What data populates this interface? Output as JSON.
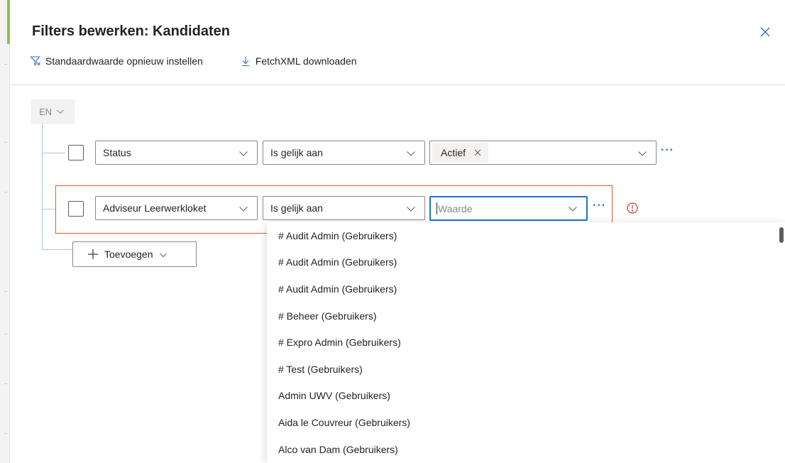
{
  "dialog": {
    "title": "Filters bewerken: Kandidaten",
    "commands": {
      "reset_label": "Standaardwaarde opnieuw instellen",
      "download_label": "FetchXML downloaden"
    }
  },
  "group": {
    "operator_label": "EN"
  },
  "rows": [
    {
      "field": "Status",
      "operator": "Is gelijk aan",
      "value_tag": "Actief",
      "more": "···"
    },
    {
      "field": "Adviseur Leerwerkloket",
      "operator": "Is gelijk aan",
      "value_placeholder": "Waarde",
      "more": "···"
    }
  ],
  "add_button": {
    "label": "Toevoegen"
  },
  "dropdown": {
    "options": [
      "# Audit Admin (Gebruikers)",
      "# Audit Admin (Gebruikers)",
      "# Audit Admin (Gebruikers)",
      "# Beheer (Gebruikers)",
      "# Expro Admin (Gebruikers)",
      "# Test (Gebruikers)",
      "Admin UWV (Gebruikers)",
      "Aida le Couvreur (Gebruikers)",
      "Alco van Dam (Gebruikers)"
    ]
  },
  "colors": {
    "accent": "#1f72c8",
    "error": "#d13438",
    "error_border": "#e05a2b",
    "tree_line": "#a8c4e6"
  },
  "icons": {
    "close": "close-icon",
    "reset": "filter-clear-icon",
    "download": "download-icon",
    "chevron": "chevron-down-icon",
    "warning": "error-circle-icon",
    "add": "plus-icon"
  }
}
